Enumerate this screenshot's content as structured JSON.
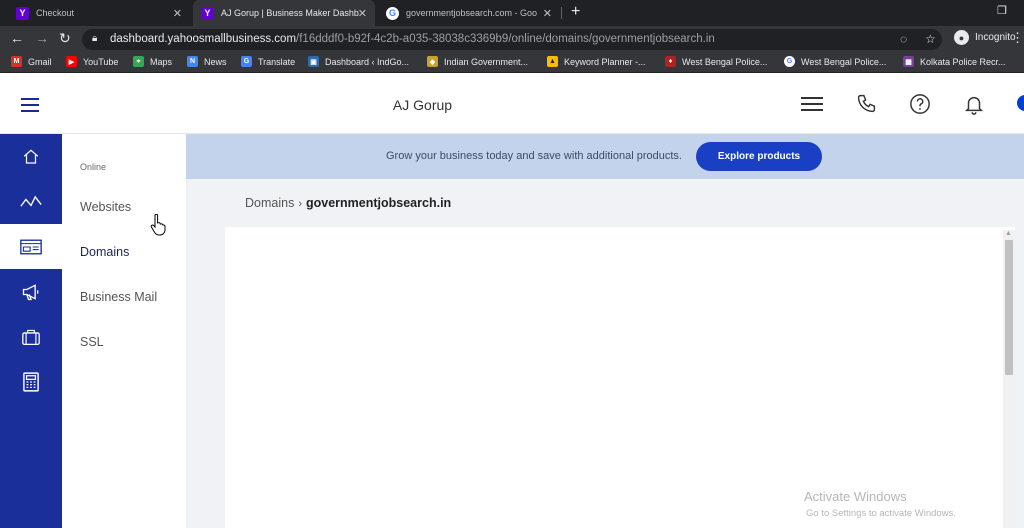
{
  "browser": {
    "tabs": [
      {
        "title": "Checkout",
        "icon": "yahoo-icon"
      },
      {
        "title": "AJ Gorup | Business Maker Dashb",
        "icon": "yahoo-icon",
        "active": true
      },
      {
        "title": "governmentjobsearch.com - Goo",
        "icon": "google-icon"
      }
    ],
    "url_host": "dashboard.yahoosmallbusiness.com",
    "url_path": "/f16dddf0-b92f-4c2b-a035-38038c3369b9/online/domains/governmentjobsearch.in",
    "incognito_label": "Incognito",
    "bookmarks": [
      "Gmail",
      "YouTube",
      "Maps",
      "News",
      "Translate",
      "Dashboard ‹ IndGo...",
      "Indian Government...",
      "Keyword Planner -...",
      "West Bengal Police...",
      "West Bengal Police...",
      "Kolkata Police Recr..."
    ]
  },
  "header": {
    "brand": "AJ Gorup"
  },
  "subnav": {
    "group_label": "Online",
    "items": [
      "Websites",
      "Domains",
      "Business Mail",
      "SSL"
    ],
    "active": "Domains"
  },
  "promo": {
    "text": "Grow your business today and save with additional products.",
    "button": "Explore products"
  },
  "breadcrumb": {
    "root": "Domains",
    "current": "governmentjobsearch.in"
  },
  "watermark": {
    "line1": "Activate Windows",
    "line2": "Go to Settings to activate Windows."
  },
  "colors": {
    "rail": "#1b2f9a",
    "accent": "#1940c4",
    "promo_bg": "#c4d3ec"
  }
}
